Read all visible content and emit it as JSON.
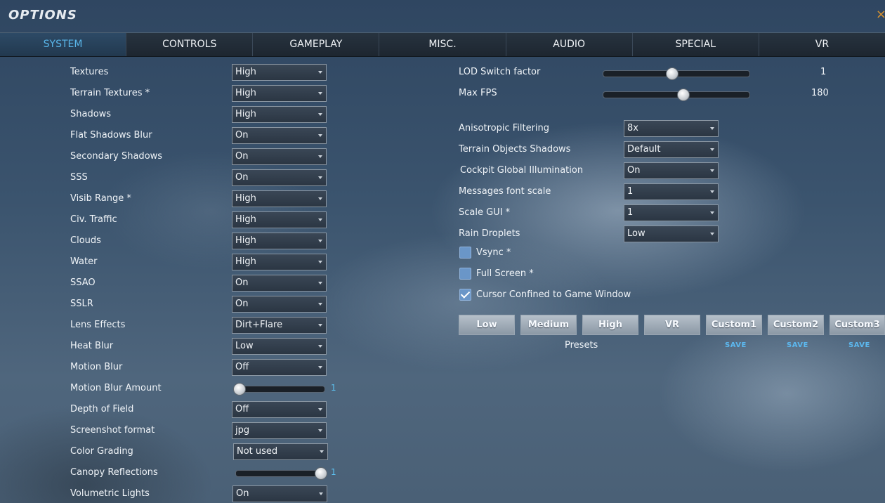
{
  "window": {
    "title": "OPTIONS",
    "close_glyph": "×"
  },
  "tabs": [
    "SYSTEM",
    "CONTROLS",
    "GAMEPLAY",
    "MISC.",
    "AUDIO",
    "SPECIAL",
    "VR"
  ],
  "active_tab": "SYSTEM",
  "left": {
    "textures": {
      "label": "Textures",
      "value": "High"
    },
    "terrain_textures": {
      "label": "Terrain Textures *",
      "value": "High"
    },
    "shadows": {
      "label": "Shadows",
      "value": "High"
    },
    "flat_shadows_blur": {
      "label": "Flat Shadows Blur",
      "value": "On"
    },
    "secondary_shadows": {
      "label": "Secondary Shadows",
      "value": "On"
    },
    "sss": {
      "label": "SSS",
      "value": "On"
    },
    "visib_range": {
      "label": "Visib Range *",
      "value": "High"
    },
    "civ_traffic": {
      "label": "Civ. Traffic",
      "value": "High"
    },
    "clouds": {
      "label": "Clouds",
      "value": "High"
    },
    "water": {
      "label": "Water",
      "value": "High"
    },
    "ssao": {
      "label": "SSAO",
      "value": "On"
    },
    "sslr": {
      "label": "SSLR",
      "value": "On"
    },
    "lens_effects": {
      "label": "Lens Effects",
      "value": "Dirt+Flare"
    },
    "heat_blur": {
      "label": "Heat Blur",
      "value": "Low"
    },
    "motion_blur": {
      "label": "Motion Blur",
      "value": "Off"
    },
    "motion_blur_amount": {
      "label": "Motion Blur Amount",
      "value": "1",
      "level": 0
    },
    "depth_of_field": {
      "label": "Depth of Field",
      "value": "Off"
    },
    "screenshot_format": {
      "label": "Screenshot format",
      "value": "jpg"
    },
    "color_grading": {
      "label": "Color Grading",
      "value": "Not used"
    },
    "canopy_reflections": {
      "label": "Canopy Reflections",
      "value": "1",
      "level": 1
    },
    "volumetric_lights": {
      "label": "Volumetric Lights",
      "value": "On"
    }
  },
  "right": {
    "lod_switch": {
      "label": "LOD Switch factor",
      "value": "1",
      "level": 0.47
    },
    "max_fps": {
      "label": "Max FPS",
      "value": "180",
      "level": 0.55
    },
    "anisotropic": {
      "label": "Anisotropic Filtering",
      "value": "8x"
    },
    "terrain_objects_shadows": {
      "label": "Terrain Objects Shadows",
      "value": "Default"
    },
    "cockpit_gi": {
      "label": "Cockpit Global Illumination",
      "value": "On"
    },
    "messages_font_scale": {
      "label": "Messages font scale",
      "value": "1"
    },
    "scale_gui": {
      "label": "Scale GUI *",
      "value": "1"
    },
    "rain_droplets": {
      "label": "Rain Droplets",
      "value": "Low"
    },
    "vsync": {
      "label": "Vsync *",
      "checked": false
    },
    "full_screen": {
      "label": "Full Screen *",
      "checked": false
    },
    "cursor_confined": {
      "label": "Cursor Confined to Game Window",
      "checked": true
    }
  },
  "presets": {
    "label": "Presets",
    "buttons": [
      "Low",
      "Medium",
      "High",
      "VR",
      "Custom1",
      "Custom2",
      "Custom3"
    ],
    "save_label": "SAVE"
  }
}
